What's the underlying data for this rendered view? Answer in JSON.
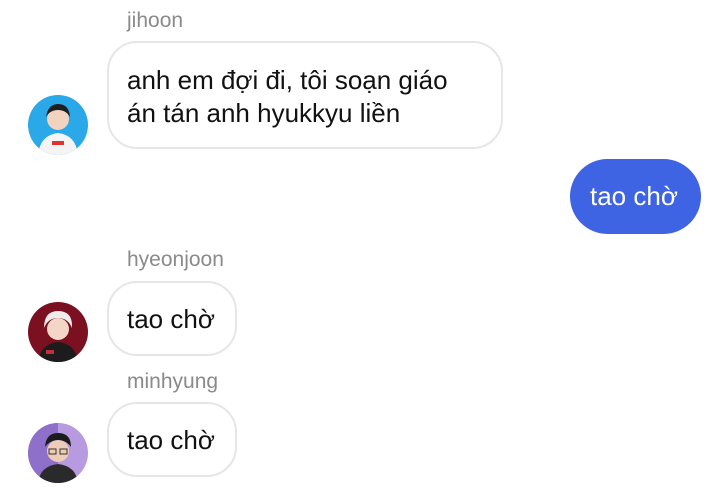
{
  "conversation": {
    "messages": [
      {
        "sender": "jihoon",
        "direction": "incoming",
        "lines": [
          "anh em đợi đi, tôi soạn giáo",
          "án tán anh hyukkyu liền"
        ],
        "avatar": "avatar-photo"
      },
      {
        "sender": "",
        "direction": "outgoing",
        "lines": [
          "tao chờ"
        ]
      },
      {
        "sender": "hyeonjoon",
        "direction": "incoming",
        "lines": [
          "tao chờ"
        ],
        "avatar": "avatar-photo"
      },
      {
        "sender": "minhyung",
        "direction": "incoming",
        "lines": [
          "tao chờ"
        ],
        "avatar": "avatar-photo"
      }
    ]
  },
  "colors": {
    "outgoing_bubble": "#3e63e3",
    "incoming_bubble_border": "#e6e6e6",
    "sender_name": "#8a8a8a",
    "background": "#ffffff"
  }
}
